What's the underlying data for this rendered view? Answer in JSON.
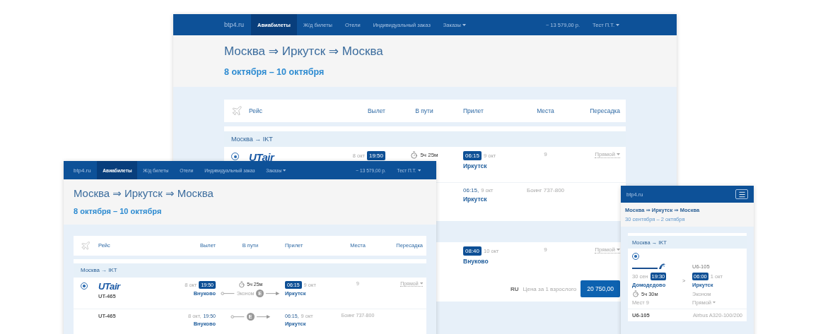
{
  "windows": [
    {
      "kind": "desktop",
      "brand": "btp4.ru",
      "nav": [
        {
          "label": "Авиабилеты",
          "selected": true,
          "dropdown": false
        },
        {
          "label": "Ж/д билеты",
          "selected": false,
          "dropdown": false
        },
        {
          "label": "Отели",
          "selected": false,
          "dropdown": false
        },
        {
          "label": "Индивидуальный заказ",
          "selected": false,
          "dropdown": false
        },
        {
          "label": "Заказы",
          "selected": false,
          "dropdown": true
        }
      ],
      "account": [
        {
          "label": "~ 13 579,00 р.",
          "dropdown": false
        },
        {
          "label": "Тест П.Т.",
          "dropdown": true
        }
      ],
      "title": "Москва ⇒ Иркутск ⇒ Москва",
      "dates": "8 октября – 10 октября",
      "columns": [
        "Рейс",
        "Вылет",
        "В пути",
        "Прилет",
        "Места",
        "Пересадка"
      ],
      "cards": [
        {
          "group": "Москва → IKT",
          "rows": [
            {
              "kind": "main",
              "selected": true,
              "logo": "UTair",
              "dep_date": "8 окт",
              "dep_time": "19:50",
              "duration": "5ч 25м",
              "arr_time": "06:15",
              "arr_date": "9 окт",
              "arr_airport": "Иркутск",
              "seats": "9",
              "transfer": "Прямой"
            },
            {
              "kind": "segment",
              "arr_time": "06:15,",
              "arr_date": "9 окт",
              "arr_airport": "Иркутск",
              "aircraft": "Боинг 737-800"
            }
          ]
        },
        {
          "rows": [
            {
              "kind": "main",
              "arr_time": "08:40",
              "arr_date": "10 окт",
              "arr_airport": "Внуково",
              "seats": "9",
              "transfer": "Прямой"
            }
          ],
          "price": {
            "currency": "RU",
            "label": "Цена за 1 взрослого",
            "amount": "20 750,00"
          }
        }
      ]
    },
    {
      "kind": "desktop",
      "brand": "btp4.ru",
      "nav": [
        {
          "label": "Авиабилеты",
          "selected": true,
          "dropdown": false
        },
        {
          "label": "Ж/д билеты",
          "selected": false,
          "dropdown": false
        },
        {
          "label": "Отели",
          "selected": false,
          "dropdown": false
        },
        {
          "label": "Индивидуальный заказ",
          "selected": false,
          "dropdown": false
        },
        {
          "label": "Заказы",
          "selected": false,
          "dropdown": true
        }
      ],
      "account": [
        {
          "label": "~ 13 579,00 р.",
          "dropdown": false
        },
        {
          "label": "Тест П.Т.",
          "dropdown": true
        }
      ],
      "title": "Москва ⇒ Иркутск ⇒ Москва",
      "dates": "8 октября – 10 октября",
      "columns": [
        "Рейс",
        "Вылет",
        "В пути",
        "Прилет",
        "Места",
        "Пересадка"
      ],
      "cards": [
        {
          "group": "Москва → IKT",
          "rows": [
            {
              "kind": "main",
              "selected": true,
              "logo": "UTair",
              "flight": "UT-465",
              "dep_date": "8 окт",
              "dep_time": "19:50",
              "dep_airport": "Внуково",
              "duration": "5ч 25м",
              "class": "Эконом",
              "class_badge": "E",
              "arr_time": "06:15",
              "arr_date": "9 окт",
              "arr_airport": "Иркутск",
              "seats": "9",
              "transfer": "Прямой"
            },
            {
              "kind": "segment",
              "flight": "UT-465",
              "dep_date": "8 окт,",
              "dep_time": "19:50",
              "dep_airport": "Внуково",
              "class_badge": "E",
              "arr_time": "06:15,",
              "arr_date": "9 окт",
              "arr_airport": "Иркутск",
              "aircraft": "Боинг 737-800"
            }
          ]
        }
      ]
    },
    {
      "kind": "mobile",
      "brand": "btp4.ru",
      "title": "Москва ⇒ Иркутск ⇒ Москва",
      "dates": "30 сентября – 2 октября",
      "group": "Москва → IKT",
      "flight": {
        "selected": true,
        "flight": "U6-105",
        "dep_date": "30 сен",
        "dep_time": "19:30",
        "dep_airport": "Домодедово",
        "separator": ">",
        "arr_time": "06:00",
        "arr_date": "1 окт",
        "arr_airport": "Иркутск",
        "duration": "5ч 30м",
        "class": "Эконом",
        "seats": "Мест 9",
        "transfer": "Прямой",
        "segment_flight": "U6-105",
        "aircraft": "Airbus A320-100/200"
      }
    }
  ]
}
